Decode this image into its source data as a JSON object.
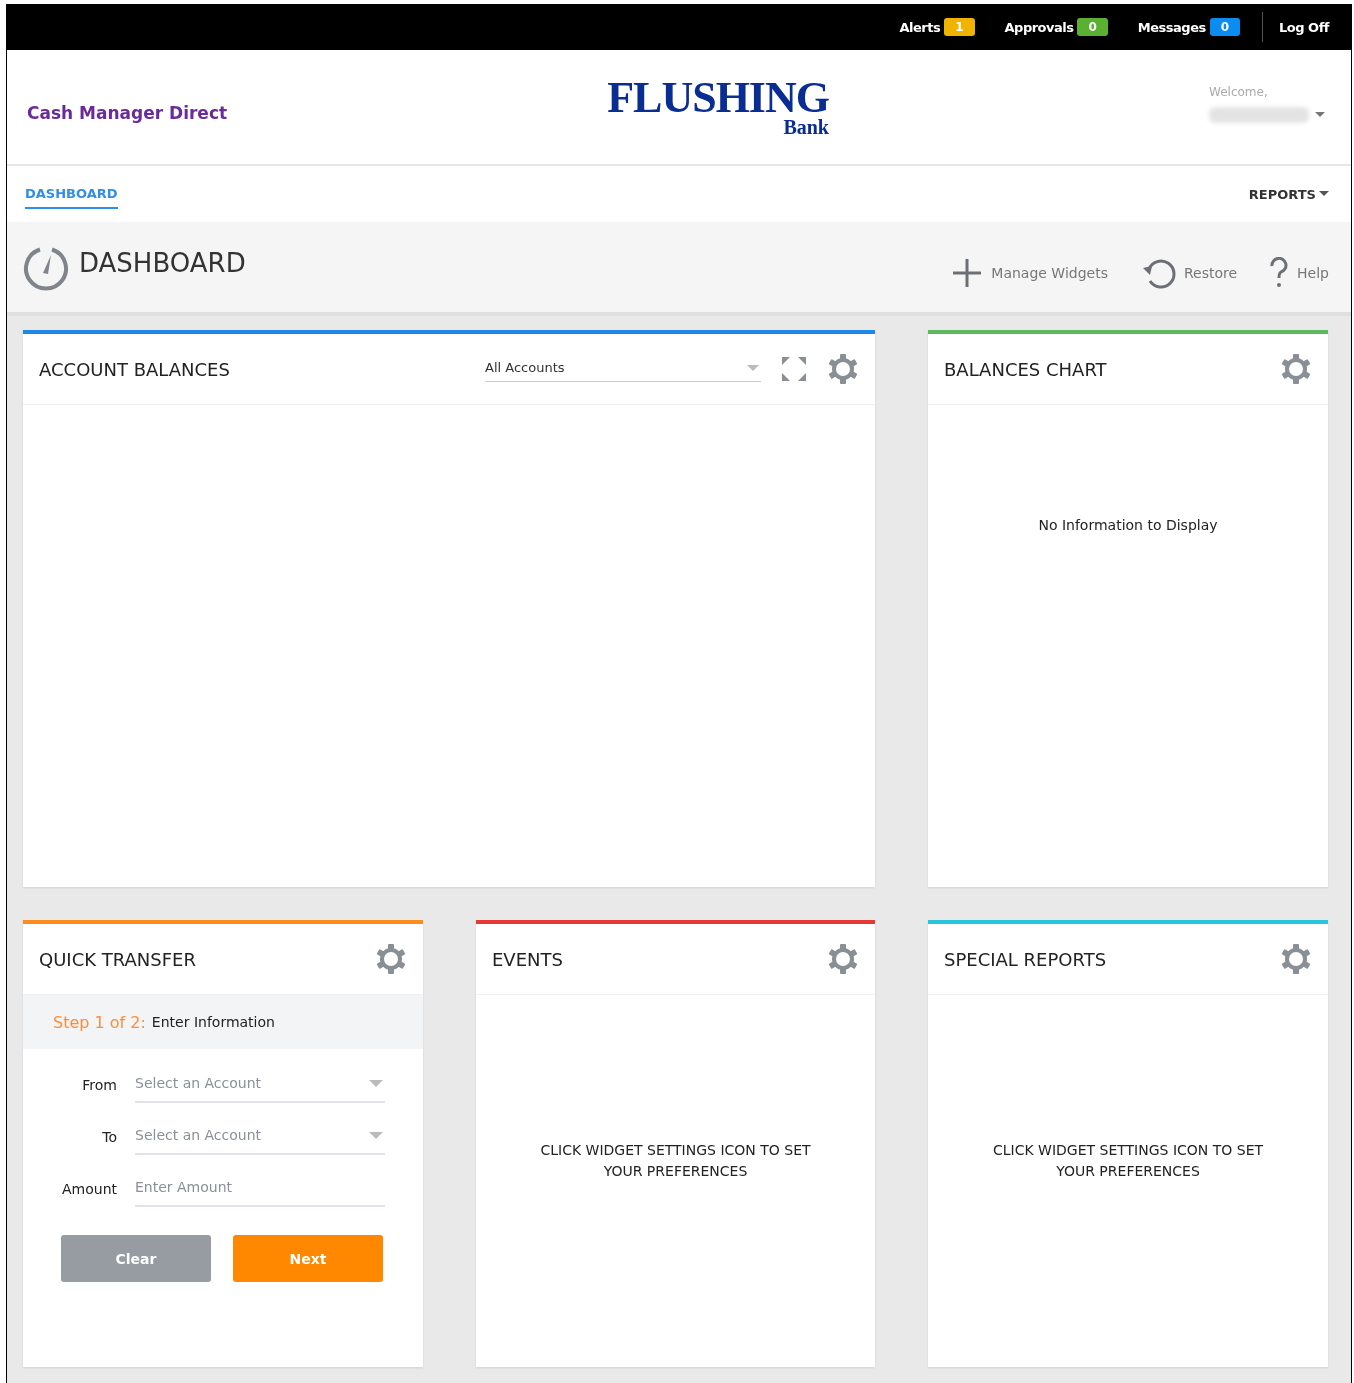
{
  "top_bar": {
    "items": [
      {
        "label": "Alerts",
        "count": "1",
        "color": "#f0b400"
      },
      {
        "label": "Approvals",
        "count": "0",
        "color": "#5ab031"
      },
      {
        "label": "Messages",
        "count": "0",
        "color": "#0a8cf0"
      }
    ],
    "log_off": "Log Off"
  },
  "header": {
    "app_name": "Cash Manager Direct",
    "logo": {
      "name": "FLUSHING",
      "sub": "Bank"
    },
    "welcome": "Welcome,"
  },
  "nav": {
    "tabs": [
      {
        "label": "DASHBOARD",
        "selected": true
      }
    ],
    "reports": "REPORTS"
  },
  "page": {
    "title": "DASHBOARD",
    "actions": [
      {
        "kind": "add",
        "label": "Manage Widgets"
      },
      {
        "kind": "restore",
        "label": "Restore"
      },
      {
        "kind": "help",
        "label": "Help"
      }
    ]
  },
  "widgets": [
    {
      "kind": "balances",
      "title": "ACCOUNT BALANCES",
      "color": "#1e88e5",
      "filter": "All Accounts"
    },
    {
      "kind": "chart",
      "title": "BALANCES CHART",
      "color": "#5cb85c",
      "message": "No Information to Display"
    },
    {
      "kind": "transfer",
      "title": "QUICK TRANSFER",
      "color": "#ff8c1a",
      "step": "Step 1 of 2:",
      "step_label": "Enter Information",
      "fields": [
        {
          "kind": "select",
          "label": "From",
          "placeholder": "Select an Account"
        },
        {
          "kind": "select",
          "label": "To",
          "placeholder": "Select an Account"
        },
        {
          "kind": "input",
          "label": "Amount",
          "placeholder": "Enter Amount"
        }
      ],
      "buttons": [
        {
          "kind": "secondary",
          "label": "Clear"
        },
        {
          "kind": "primary",
          "label": "Next"
        }
      ]
    },
    {
      "kind": "message",
      "title": "EVENTS",
      "color": "#e53935",
      "message": "CLICK WIDGET SETTINGS ICON TO SET YOUR PREFERENCES"
    },
    {
      "kind": "message",
      "title": "SPECIAL REPORTS",
      "color": "#26c6da",
      "message": "CLICK WIDGET SETTINGS ICON TO SET YOUR PREFERENCES"
    }
  ]
}
